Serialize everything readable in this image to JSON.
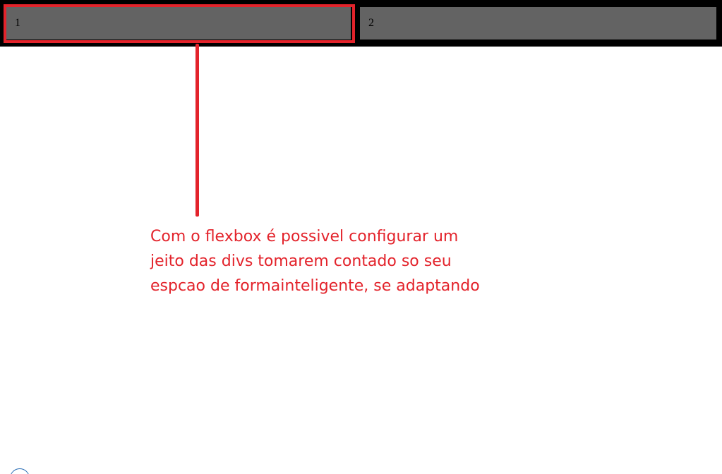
{
  "flex_container": {
    "items": [
      {
        "label": "1"
      },
      {
        "label": "2"
      }
    ]
  },
  "annotation": {
    "text": "Com o flexbox é possivel configurar um jeito das divs tomarem contado so seu espcao de formainteligente, se adaptando"
  },
  "colors": {
    "annotation_red": "#e3232b",
    "container_bg": "#000000",
    "item_bg": "#636363"
  }
}
